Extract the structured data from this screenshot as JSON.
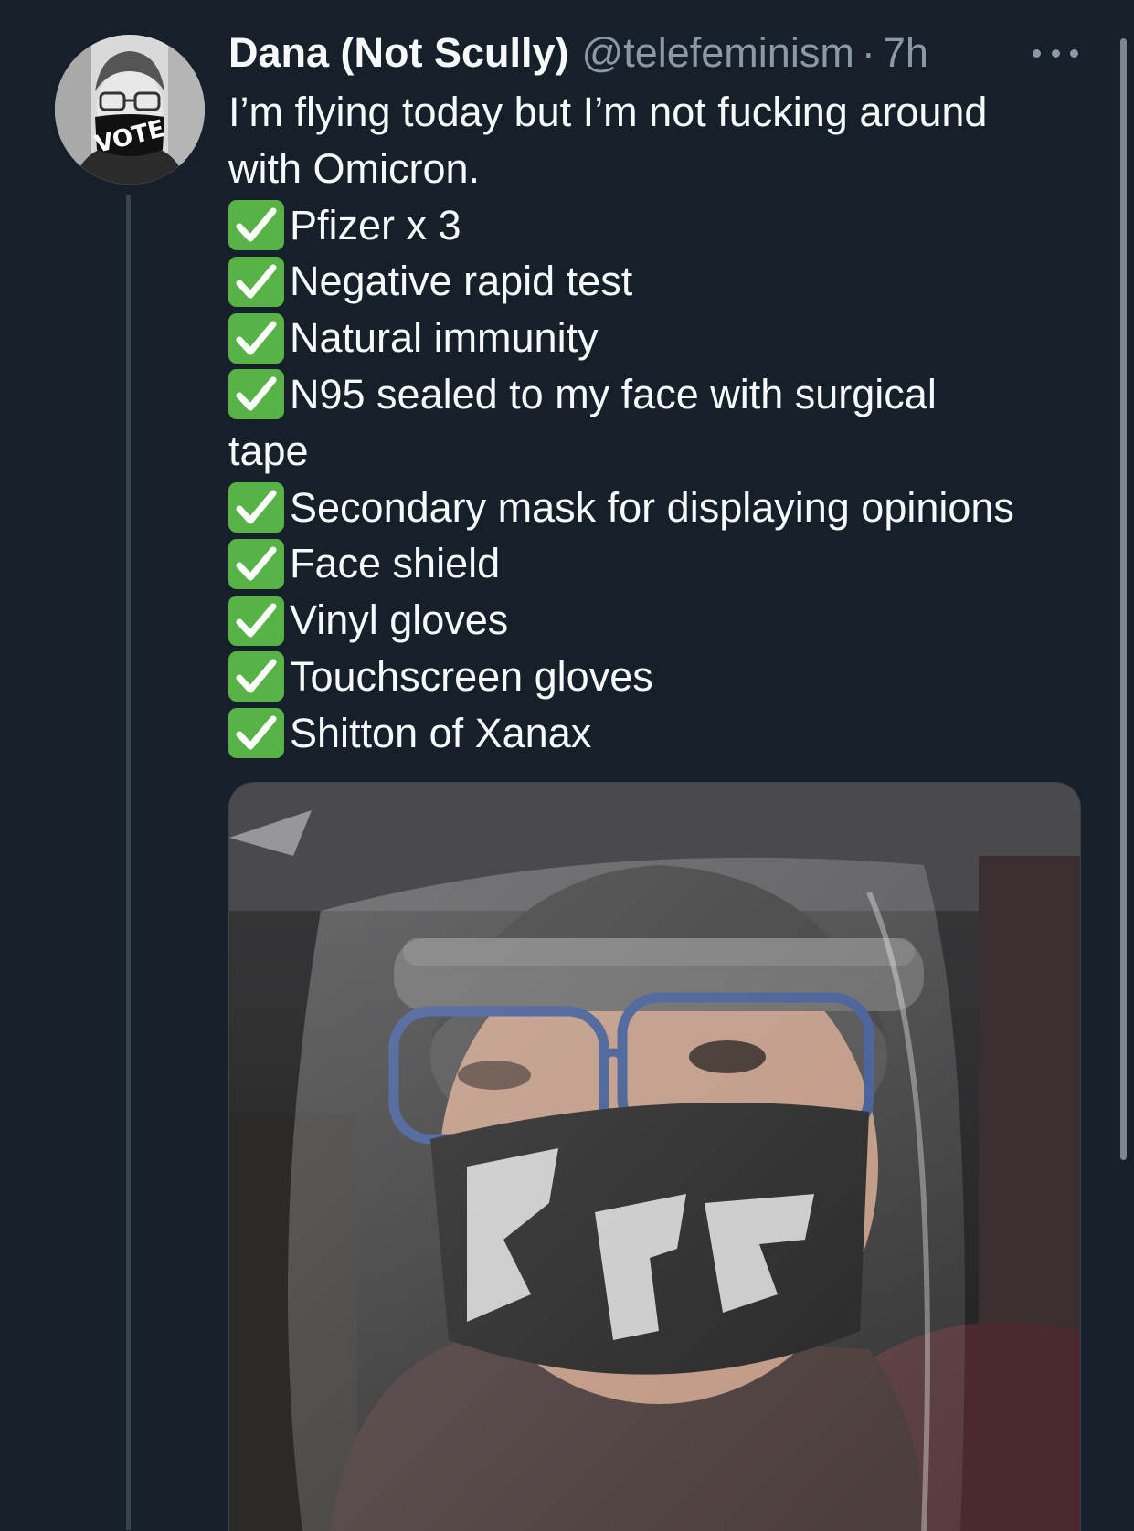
{
  "tweet": {
    "display_name": "Dana (Not Scully)",
    "handle": "@telefeminism",
    "separator": "·",
    "time": "7h",
    "intro_line_1": "I’m flying today but I’m not fucking around",
    "intro_line_2": "with Omicron.",
    "checklist": [
      "Pfizer x 3",
      "Negative rapid test",
      "Natural immunity",
      "N95 sealed to my face with surgical",
      "Secondary mask for displaying opinions",
      "Face shield",
      "Vinyl gloves",
      "Touchscreen gloves",
      "Shitton of Xanax"
    ],
    "continuation": "tape"
  },
  "avatar": {
    "mask_text": "VOTE"
  },
  "colors": {
    "background": "#15202b",
    "text": "#f7f9f9",
    "muted": "#8b98a5",
    "check_green": "#58b347",
    "thread_line": "#38444d"
  },
  "icons": {
    "more": "more-horizontal-icon",
    "check": "white-check-mark-emoji"
  }
}
